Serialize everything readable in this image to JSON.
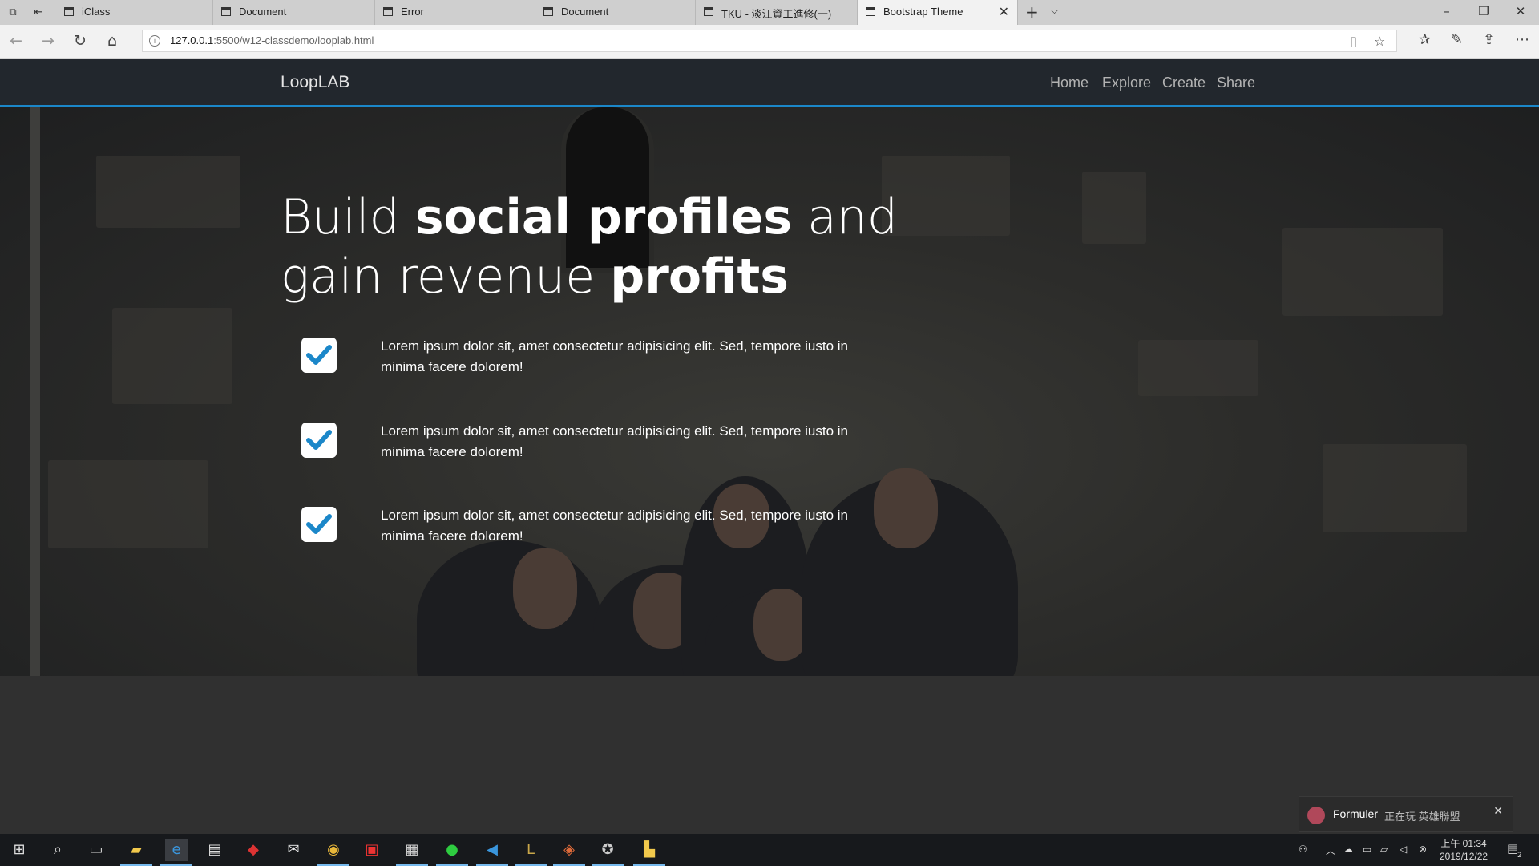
{
  "browser": {
    "tabs": [
      {
        "label": "iClass"
      },
      {
        "label": "Document"
      },
      {
        "label": "Error"
      },
      {
        "label": "Document"
      },
      {
        "label": "TKU - 淡江資工進修(一)"
      },
      {
        "label": "Bootstrap Theme",
        "active": true
      }
    ],
    "url_host": "127.0.0.1",
    "url_path": ":5500/w12-classdemo/looplab.html"
  },
  "site": {
    "brand": "LoopLAB",
    "nav": [
      "Home",
      "Explore",
      "Create",
      "Share"
    ],
    "accent_color": "#1b87c9"
  },
  "hero": {
    "headline_parts": [
      "Build ",
      "social profiles",
      " and gain revenue ",
      "profits"
    ],
    "items": [
      {
        "text": "Lorem ipsum dolor sit, amet consectetur adipisicing elit. Sed, tempore iusto in minima facere dolorem!"
      },
      {
        "text": "Lorem ipsum dolor sit, amet consectetur adipisicing elit. Sed, tempore iusto in minima facere dolorem!"
      },
      {
        "text": "Lorem ipsum dolor sit, amet consectetur adipisicing elit. Sed, tempore iusto in minima facere dolorem!"
      }
    ]
  },
  "notification": {
    "name": "Formuler",
    "message": "正在玩 英雄聯盟"
  },
  "taskbar": {
    "clock_time": "上午 01:34",
    "clock_date": "2019/12/22",
    "notif_count": "2"
  }
}
